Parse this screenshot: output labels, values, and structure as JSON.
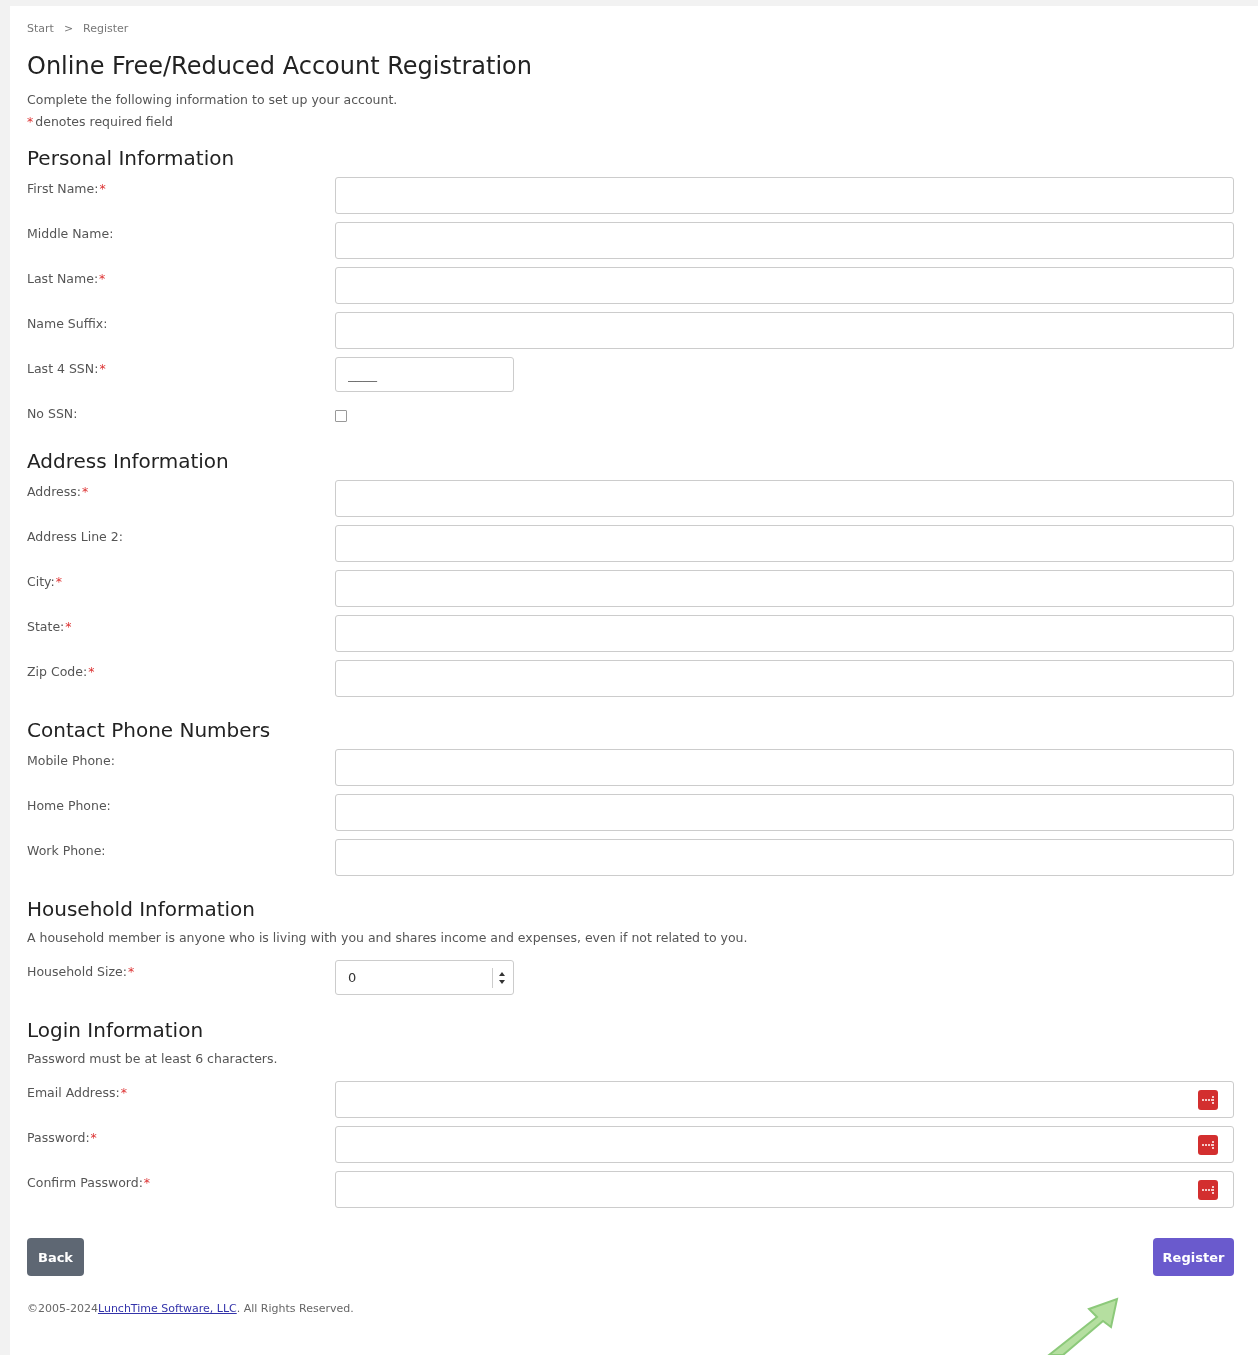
{
  "breadcrumb": [
    {
      "label": "Start"
    },
    {
      "label": "Register"
    }
  ],
  "breadcrumb_separator": ">",
  "title": "Online Free/Reduced Account Registration",
  "intro": "Complete the following information to set up your account.",
  "required_note": {
    "mark": "*",
    "text": "denotes required field"
  },
  "sections": [
    {
      "title": "Personal Information",
      "fields": [
        {
          "kind": "text",
          "label": "First Name:",
          "required_mark": "*"
        },
        {
          "kind": "text",
          "label": "Middle Name:"
        },
        {
          "kind": "text",
          "label": "Last Name:",
          "required_mark": "*"
        },
        {
          "kind": "text",
          "label": "Name Suffix:"
        },
        {
          "kind": "short",
          "label": "Last 4 SSN:",
          "required_mark": "*",
          "placeholder": "____"
        },
        {
          "kind": "checkbox",
          "label": "No SSN:",
          "checked": false
        }
      ]
    },
    {
      "title": "Address Information",
      "fields": [
        {
          "kind": "text",
          "label": "Address:",
          "required_mark": "*"
        },
        {
          "kind": "text",
          "label": "Address Line 2:"
        },
        {
          "kind": "text",
          "label": "City:",
          "required_mark": "*"
        },
        {
          "kind": "text",
          "label": "State:",
          "required_mark": "*"
        },
        {
          "kind": "text",
          "label": "Zip Code:",
          "required_mark": "*"
        }
      ]
    },
    {
      "title": "Contact Phone Numbers",
      "fields": [
        {
          "kind": "text",
          "label": "Mobile Phone:"
        },
        {
          "kind": "text",
          "label": "Home Phone:"
        },
        {
          "kind": "text",
          "label": "Work Phone:"
        }
      ]
    },
    {
      "title": "Household Information",
      "note": "A household member is anyone who is living with you and shares income and expenses, even if not related to you.",
      "fields": [
        {
          "kind": "number",
          "label": "Household Size:",
          "required_mark": "*",
          "value": "0"
        }
      ]
    },
    {
      "title": "Login Information",
      "note": "Password must be at least 6 characters.",
      "fields": [
        {
          "kind": "managed",
          "label": "Email Address:",
          "required_mark": "*"
        },
        {
          "kind": "managed",
          "label": "Password:",
          "required_mark": "*"
        },
        {
          "kind": "managed",
          "label": "Confirm Password:",
          "required_mark": "*"
        }
      ]
    }
  ],
  "buttons": {
    "back": "Back",
    "register": "Register"
  },
  "footer": {
    "before": "©2005-2024",
    "link": "LunchTime Software, LLC",
    "after": ". All Rights Reserved."
  }
}
